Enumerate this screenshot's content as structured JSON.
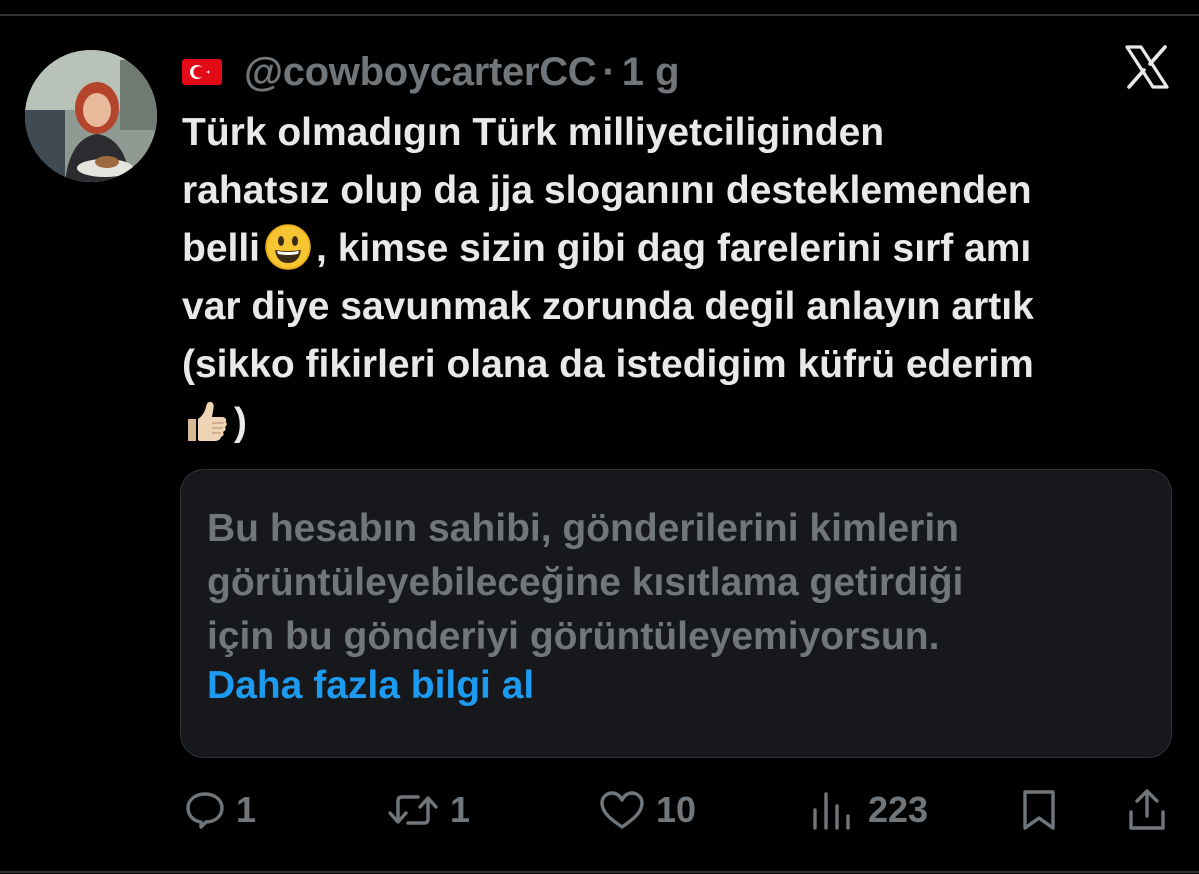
{
  "author": {
    "handle": "@cowboycarterCC",
    "separator": "·",
    "time": "1 g"
  },
  "icons": {
    "flag": "turkey-flag-emoji",
    "brand": "x-logo-icon",
    "emoji_smile": "grinning-face-emoji",
    "emoji_thumbs": "thumbs-up-emoji"
  },
  "tweet": {
    "line1": "Türk olmadıgın Türk milliyetciliginden",
    "line2": "rahatsız olup da jja sloganını desteklemenden",
    "line3_start": "belli",
    "line3_end": ", kimse sizin gibi dag farelerini sırf amı",
    "line4": "var diye savunmak zorunda degil anlayın artık",
    "line5": "(sikko fikirleri olana da istedigim küfrü ederim",
    "line6_end": ")"
  },
  "notice": {
    "line1": "Bu hesabın sahibi, gönderilerini kimlerin",
    "line2": "görüntüleyebileceğine kısıtlama getirdiği",
    "line3": "için bu gönderiyi görüntüleyemiyorsun.",
    "link": "Daha fazla bilgi al"
  },
  "actions": {
    "replies": "1",
    "reposts": "1",
    "likes": "10",
    "views": "223"
  },
  "colors": {
    "background": "#000000",
    "text": "#e7e9ea",
    "muted": "#71767b",
    "link": "#1d9bf0",
    "card": "#16181c"
  }
}
